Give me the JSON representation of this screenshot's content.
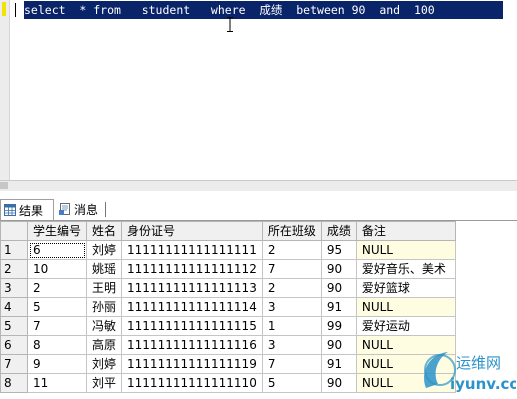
{
  "editor": {
    "sql_text": "select  * from   student   where  成绩  between 90  and  100"
  },
  "tabs": [
    {
      "label": "结果",
      "icon": "grid-icon"
    },
    {
      "label": "消息",
      "icon": "message-icon"
    }
  ],
  "grid": {
    "columns": [
      "学生编号",
      "姓名",
      "身份证号",
      "所在班级",
      "成绩",
      "备注"
    ],
    "rows": [
      [
        "1",
        "6",
        "刘婷",
        "11111111111111111",
        "2",
        "95",
        "NULL"
      ],
      [
        "2",
        "10",
        "姚瑶",
        "11111111111111112",
        "7",
        "90",
        "爱好音乐、美术"
      ],
      [
        "3",
        "2",
        "王明",
        "11111111111111113",
        "2",
        "90",
        "爱好篮球"
      ],
      [
        "4",
        "5",
        "孙丽",
        "11111111111111114",
        "3",
        "91",
        "NULL"
      ],
      [
        "5",
        "7",
        "冯敏",
        "11111111111111115",
        "1",
        "99",
        "爱好运动"
      ],
      [
        "6",
        "8",
        "高原",
        "11111111111111116",
        "3",
        "90",
        "NULL"
      ],
      [
        "7",
        "9",
        "刘婷",
        "11111111111111119",
        "7",
        "91",
        "NULL"
      ],
      [
        "8",
        "11",
        "刘平",
        "11111111111111110",
        "5",
        "90",
        "NULL"
      ]
    ]
  },
  "watermark": {
    "name": "运维网",
    "domain": "iyunv.com",
    "color": "#2b93c9"
  }
}
